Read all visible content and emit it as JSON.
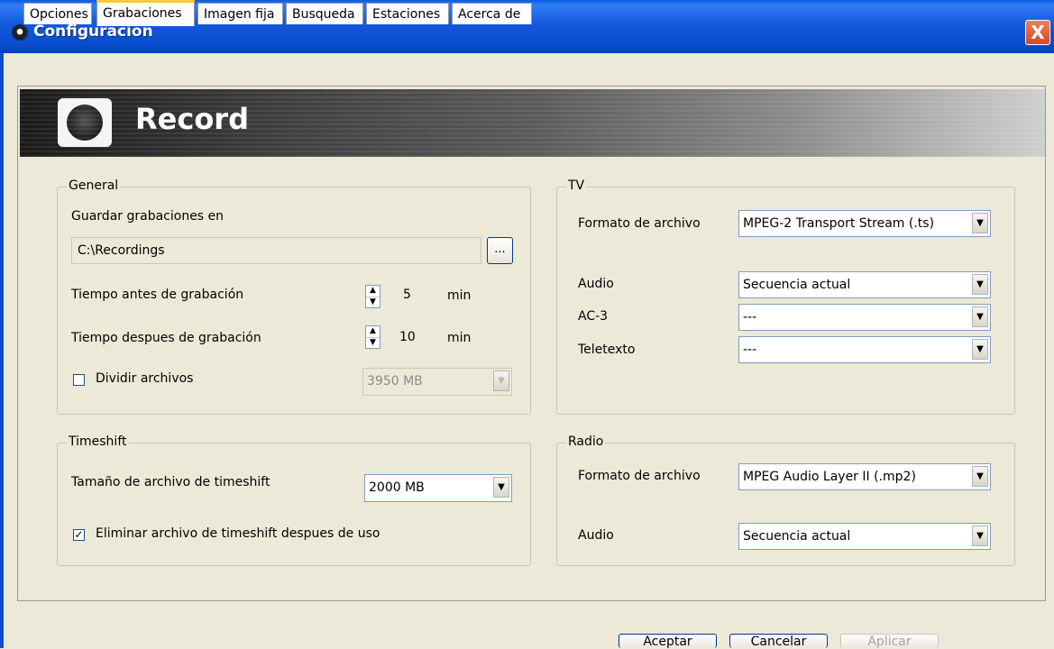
{
  "window": {
    "title": "Configuracion",
    "close_label": "X"
  },
  "tabs": [
    "Opciones",
    "Grabaciones",
    "Imagen fija",
    "Busqueda",
    "Estaciones",
    "Acerca de"
  ],
  "active_tab": "Grabaciones",
  "banner": {
    "title": "Record"
  },
  "general": {
    "legend": "General",
    "save_label": "Guardar grabaciones en",
    "path_value": "C:\\Recordings",
    "browse_label": "...",
    "before_label": "Tiempo antes de grabación",
    "before_value": "5",
    "after_label": "Tiempo despues de grabación",
    "after_value": "10",
    "unit": "min",
    "split_label": "Dividir archivos",
    "split_checked": false,
    "split_value": "3950 MB"
  },
  "timeshift": {
    "legend": "Timeshift",
    "size_label": "Tamaño de archivo de timeshift",
    "size_value": "2000 MB",
    "delete_label": "Eliminar archivo de timeshift despues de uso",
    "delete_checked": true
  },
  "tv": {
    "legend": "TV",
    "format_label": "Formato de archivo",
    "format_value": "MPEG-2 Transport Stream (.ts)",
    "audio_label": "Audio",
    "audio_value": "Secuencia actual",
    "ac3_label": "AC-3",
    "ac3_value": "---",
    "teletext_label": "Teletexto",
    "teletext_value": "---"
  },
  "radio": {
    "legend": "Radio",
    "format_label": "Formato de archivo",
    "format_value": "MPEG Audio Layer II (.mp2)",
    "audio_label": "Audio",
    "audio_value": "Secuencia actual"
  },
  "footer": {
    "accept": "Aceptar",
    "cancel": "Cancelar",
    "apply": "Aplicar"
  }
}
